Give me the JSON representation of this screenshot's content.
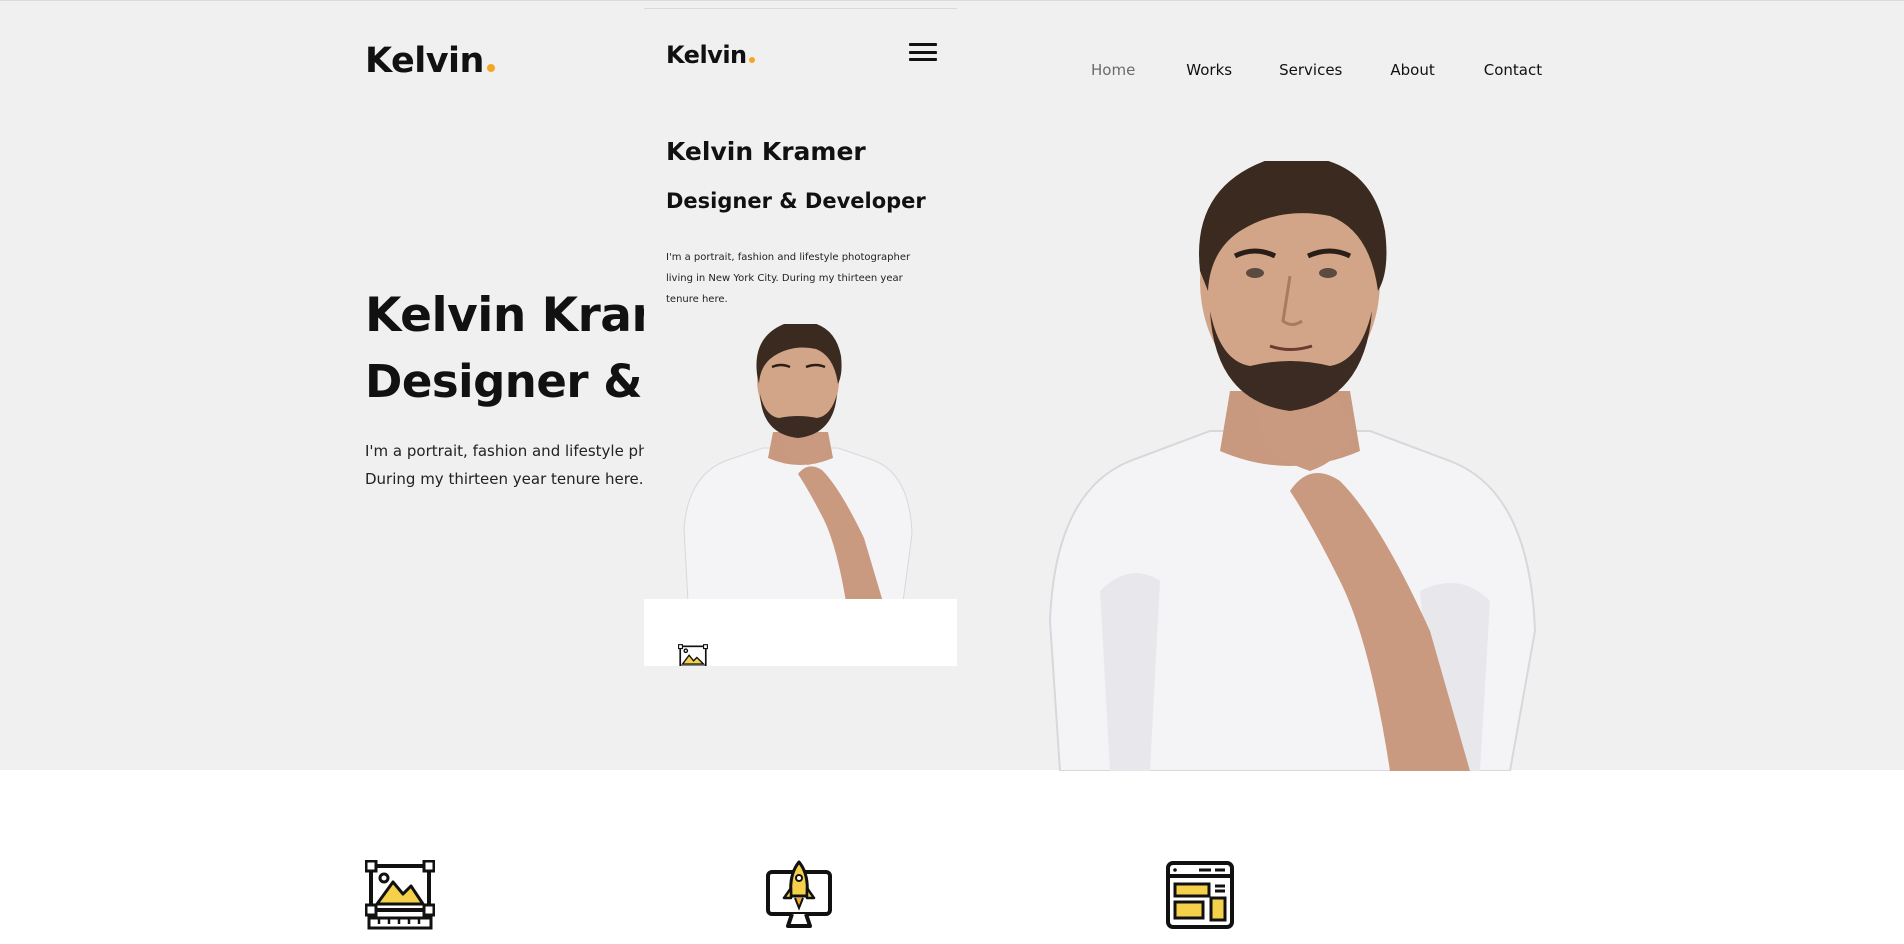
{
  "brand": {
    "name": "Kelvin",
    "accent_color": "#f5a623"
  },
  "nav": {
    "items": [
      {
        "label": "Home",
        "active": true
      },
      {
        "label": "Works"
      },
      {
        "label": "Services"
      },
      {
        "label": "About"
      },
      {
        "label": "Contact"
      }
    ]
  },
  "hero": {
    "name": "Kelvin Kramer",
    "role": "Designer & Developer",
    "description_lines": [
      "I'm a portrait, fashion and lifestyle photographer living in New York City.",
      "During my thirteen year tenure here."
    ]
  },
  "mobile_preview": {
    "brand": "Kelvin",
    "name": "Kelvin Kramer",
    "role": "Designer & Developer",
    "description_lines": [
      "I'm a portrait, fashion and lifestyle photographer",
      "living in New York City. During my thirteen year",
      "tenure here."
    ]
  },
  "services": {
    "icons": [
      "image-design-icon",
      "rocket-monitor-icon",
      "web-layout-icon"
    ]
  }
}
